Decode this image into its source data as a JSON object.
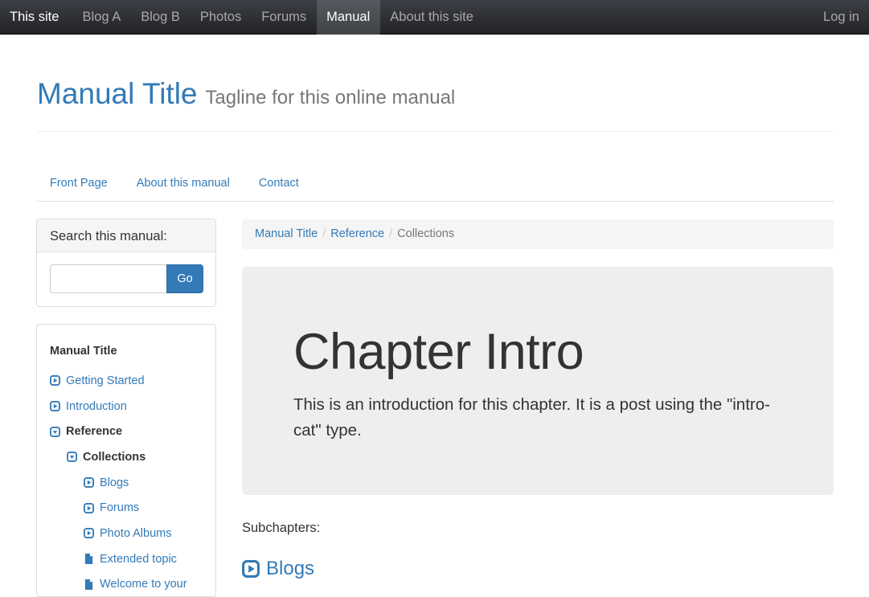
{
  "topnav": {
    "brand": "This site",
    "items": [
      {
        "label": "Blog A",
        "active": false
      },
      {
        "label": "Blog B",
        "active": false
      },
      {
        "label": "Photos",
        "active": false
      },
      {
        "label": "Forums",
        "active": false
      },
      {
        "label": "Manual",
        "active": true
      },
      {
        "label": "About this site",
        "active": false
      }
    ],
    "login": "Log in"
  },
  "header": {
    "title": "Manual Title",
    "tagline": "Tagline for this online manual"
  },
  "subnav": {
    "items": [
      {
        "label": "Front Page"
      },
      {
        "label": "About this manual"
      },
      {
        "label": "Contact"
      }
    ]
  },
  "search": {
    "heading": "Search this manual:",
    "value": "",
    "placeholder": "",
    "button": "Go"
  },
  "toc": {
    "title": "Manual Title",
    "items": [
      {
        "label": "Getting Started",
        "icon": "play-square-icon",
        "level": 1,
        "bold": false
      },
      {
        "label": "Introduction",
        "icon": "play-square-icon",
        "level": 1,
        "bold": false
      },
      {
        "label": "Reference",
        "icon": "collapse-down-square-icon",
        "level": 1,
        "bold": true
      },
      {
        "label": "Collections",
        "icon": "collapse-down-square-icon",
        "level": 2,
        "bold": true
      },
      {
        "label": "Blogs",
        "icon": "play-square-icon",
        "level": 3,
        "bold": false
      },
      {
        "label": "Forums",
        "icon": "play-square-icon",
        "level": 3,
        "bold": false
      },
      {
        "label": "Photo Albums",
        "icon": "play-square-icon",
        "level": 3,
        "bold": false
      },
      {
        "label": "Extended topic",
        "icon": "document-icon",
        "level": 3,
        "bold": false
      },
      {
        "label": "Welcome to your",
        "icon": "document-icon",
        "level": 3,
        "bold": false
      }
    ]
  },
  "breadcrumb": {
    "items": [
      {
        "label": "Manual Title",
        "link": true
      },
      {
        "label": "Reference",
        "link": true
      },
      {
        "label": "Collections",
        "link": false
      }
    ]
  },
  "jumbotron": {
    "title": "Chapter Intro",
    "text": "This is an introduction for this chapter. It is a post using the \"intro-cat\" type."
  },
  "subchapters": {
    "label": "Subchapters:",
    "items": [
      {
        "label": "Blogs",
        "icon": "play-square-icon"
      }
    ]
  },
  "colors": {
    "link": "#337ab7",
    "navbar_top": "#3c3f45",
    "navbar_bottom": "#222326",
    "jumbotron_bg": "#eeeeee",
    "text": "#333333",
    "muted": "#777777"
  }
}
